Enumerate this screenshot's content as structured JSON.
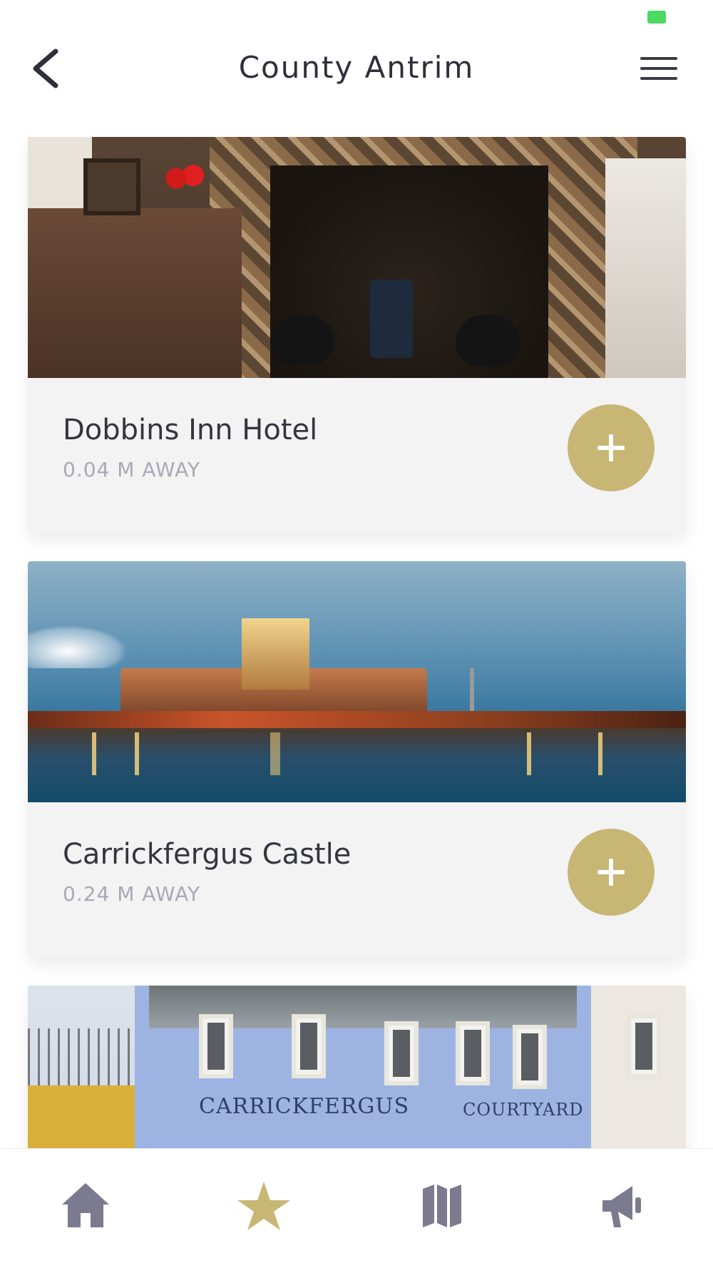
{
  "header": {
    "title": "County Antrim",
    "back_icon": "chevron-left-icon",
    "menu_icon": "hamburger-menu-icon"
  },
  "colors": {
    "accent": "#c8b675",
    "text_primary": "#35353f",
    "text_secondary": "#a9a9b7",
    "card_bg": "#f3f3f3",
    "nav_inactive": "#7b7a8e"
  },
  "places": [
    {
      "name": "Dobbins Inn Hotel",
      "distance": "0.04 M AWAY",
      "image": "fireplace-photo"
    },
    {
      "name": "Carrickfergus Castle",
      "distance": "0.24 M AWAY",
      "image": "castle-dusk-photo"
    },
    {
      "name": "",
      "distance": "",
      "image": "courtyard-building-photo",
      "sign_left": "CARRICKFERGUS",
      "sign_right": "COURTYARD"
    }
  ],
  "tabbar": {
    "items": [
      {
        "icon": "home-icon",
        "active": false
      },
      {
        "icon": "star-icon",
        "active": true
      },
      {
        "icon": "map-icon",
        "active": false
      },
      {
        "icon": "megaphone-icon",
        "active": false
      }
    ]
  }
}
